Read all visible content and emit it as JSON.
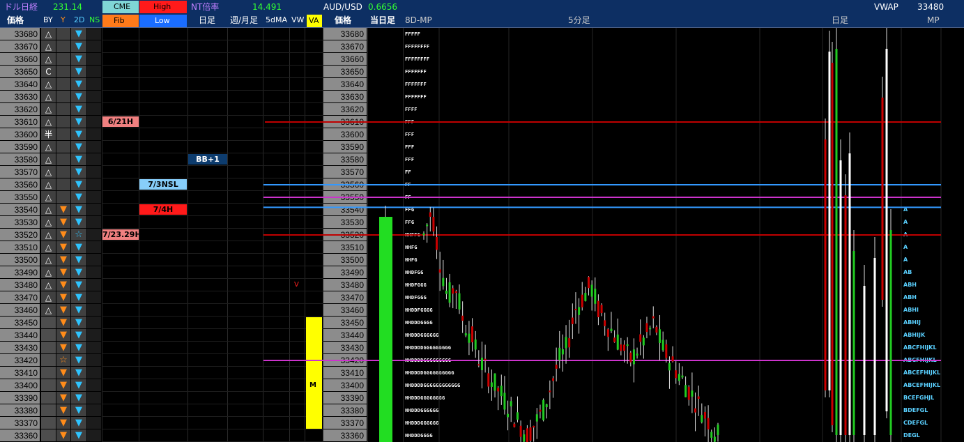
{
  "header": {
    "doru_label": "ドル日経",
    "doru_value": "231.14",
    "cme_label": "CME",
    "high_label": "High",
    "nt_label": "NT倍率",
    "nt_value": "14.491",
    "aud_label": "AUD/USD",
    "aud_value": "0.6656",
    "vwap_label": "VWAP",
    "vwap_value": "33480",
    "col_price": "価格",
    "col_by": "BY",
    "col_y": "Y",
    "col_2d": "2D",
    "col_ns": "NS",
    "fib_label": "Fib",
    "low_label": "Low",
    "col_daily": "日足",
    "col_weekly": "週/月足",
    "col_5dma": "5dMA",
    "col_vw": "VW",
    "col_va": "VA",
    "col_price2": "価格",
    "col_today": "当日足",
    "col_8d": "8D-MP",
    "col_5min": "5分足",
    "col_daily2": "日足",
    "col_mp": "MP"
  },
  "prices": [
    "33680",
    "33670",
    "33660",
    "33650",
    "33640",
    "33630",
    "33620",
    "33610",
    "33600",
    "33590",
    "33580",
    "33570",
    "33560",
    "33550",
    "33540",
    "33530",
    "33520",
    "33510",
    "33500",
    "33490",
    "33480",
    "33470",
    "33460",
    "33450",
    "33440",
    "33430",
    "33420",
    "33410",
    "33400",
    "33390",
    "33380",
    "33370",
    "33360"
  ],
  "by_symbols": [
    "△",
    "△",
    "△",
    "C",
    "△",
    "△",
    "△",
    "△",
    "半",
    "△",
    "△",
    "△",
    "△",
    "△",
    "△",
    "△",
    "△",
    "△",
    "△",
    "△",
    "△",
    "△",
    "△",
    "",
    "",
    "",
    "",
    "",
    "",
    "",
    "",
    "",
    ""
  ],
  "y_symbols": [
    "",
    "",
    "",
    "",
    "",
    "",
    "",
    "",
    "",
    "",
    "",
    "",
    "",
    "",
    "▼",
    "▼",
    "▼",
    "▼",
    "▼",
    "▼",
    "▼",
    "▼",
    "▼",
    "▼",
    "▼",
    "▼",
    "☆",
    "▼",
    "▼",
    "▼",
    "▼",
    "▼",
    "▼"
  ],
  "d2_symbols": [
    "▼",
    "▼",
    "▼",
    "▼",
    "▼",
    "▼",
    "▼",
    "▼",
    "▼",
    "▼",
    "▼",
    "▼",
    "▼",
    "▼",
    "▼",
    "▼",
    "☆",
    "▼",
    "▼",
    "▼",
    "▼",
    "▼",
    "▼",
    "▼",
    "▼",
    "▼",
    "▼",
    "▼",
    "▼",
    "▼",
    "▼",
    "▼",
    "▼"
  ],
  "fib_tags": [
    {
      "label": "6/21H",
      "row": 7,
      "color": "#f08080"
    },
    {
      "label": "7/23.29H",
      "row": 16,
      "color": "#f08080"
    }
  ],
  "low_tags": [
    {
      "label": "7/3NSL",
      "row": 12,
      "color": "#87cefa"
    },
    {
      "label": "7/4H",
      "row": 14,
      "color": "#ff1a1a"
    }
  ],
  "daily_tags": [
    {
      "label": "BB+1",
      "row": 10,
      "color": "#0d3c6e"
    }
  ],
  "vw_marker": {
    "label": "V",
    "row": 20
  },
  "va_marker": {
    "label": "M",
    "row": 28
  },
  "mp8d": [
    "FFFFF",
    "FFFFFFFF",
    "FFFFFFFF",
    "FFFFFFF",
    "FFFFFFF",
    "FFFFFFF",
    "FFFF",
    "FFF",
    "FFF",
    "FFF",
    "FFF",
    "FF",
    "FF",
    "FF",
    "FFG",
    "FFG",
    "HHFFG",
    "HHFG",
    "HHFG",
    "HHDFGG",
    "HHDFGGG",
    "HHDFGGG",
    "HHDDFGGGG",
    "HHDDDGGGG",
    "HHDDDGGGGGG",
    "HHDDDDGGGGGGGGG",
    "HHDDDDGGGGGGGGG",
    "HHDDDDGGGGGGGGGG",
    "HHDDDDGGGGGGGGGGGG",
    "HHDDDGGGGGGGG",
    "HHDDDGGGGGG",
    "HHDDDGGGGGG",
    "HHDDDGGGG"
  ],
  "mp_today": [
    "",
    "",
    "",
    "",
    "",
    "",
    "",
    "",
    "",
    "",
    "",
    "",
    "",
    "",
    "A",
    "A",
    "A",
    "A",
    "A",
    "AB",
    "ABH",
    "ABH",
    "ABHI",
    "ABHIJ",
    "ABHIJK",
    "ABCFHIJKL",
    "ABCFHIJKL",
    "ABCEFHIJKL",
    "ABCEFHIJKL",
    "BCEFGHJL",
    "BDEFGL",
    "CDEFGL",
    "DEGL"
  ],
  "h_lines": [
    {
      "name": "line-33610",
      "price": 33610,
      "color": "#c00000"
    },
    {
      "name": "line-33560",
      "price": 33560,
      "color": "#3399ff"
    },
    {
      "name": "line-33550",
      "price": 33550,
      "color": "#cc33cc"
    },
    {
      "name": "line-33542",
      "price": 33542,
      "color": "#3399ff"
    },
    {
      "name": "line-33520",
      "price": 33520,
      "color": "#c00000"
    },
    {
      "name": "line-33420",
      "price": 33420,
      "color": "#cc33cc"
    }
  ],
  "today_bar": {
    "open": 33530,
    "close": 33360,
    "high": 33540,
    "low": 33360,
    "color": "#22dd22"
  },
  "colors": {
    "header_bg": "#0d2f63",
    "price_bg": "#8c8c8c",
    "green": "#22cc22",
    "red": "#cc0000",
    "yellow": "#ffff00",
    "grid": "#1e1e1e"
  }
}
